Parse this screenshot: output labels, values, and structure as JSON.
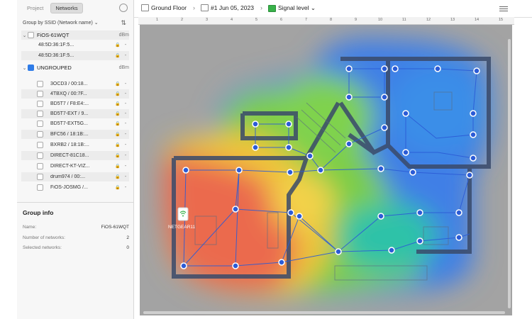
{
  "sidebar": {
    "tabs": [
      {
        "label": "Project",
        "active": false
      },
      {
        "label": "Networks",
        "active": true
      }
    ],
    "group_by": "Group by SSID (Network name) ⌄",
    "groups": [
      {
        "name": "FiOS-61WQT",
        "unit": "dBm",
        "networks": [
          {
            "name": "48:5D:36:1F:5..."
          },
          {
            "name": "48:5D:36:1F:5..."
          }
        ]
      },
      {
        "name": "UNGROUPED",
        "unit": "dBm",
        "networks": [
          {
            "name": "3OCD3 / 00:18..."
          },
          {
            "name": "4TBXQ / 00:7F..."
          },
          {
            "name": "BD5T7 / F8:E4:..."
          },
          {
            "name": "BD5T7-EXT / 9..."
          },
          {
            "name": "BD5T7-EXT5G..."
          },
          {
            "name": "BFC56 / 18:1B:..."
          },
          {
            "name": "BXRB2 / 18:1B:..."
          },
          {
            "name": "DIRECT-81C18..."
          },
          {
            "name": "DIRECT-KT-VIZ..."
          },
          {
            "name": "drum974 / 00:..."
          },
          {
            "name": "FiOS-JOSMG /..."
          }
        ]
      }
    ],
    "group_info": {
      "title": "Group info",
      "rows": [
        {
          "label": "Name:",
          "value": "FiOS-61WQT"
        },
        {
          "label": "Number of networks:",
          "value": "2"
        },
        {
          "label": "Selected networks:",
          "value": "0"
        }
      ]
    }
  },
  "topbar": {
    "crumbs": [
      "Ground Floor",
      "#1 Jun 05, 2023",
      "Signal level ⌄"
    ]
  },
  "ruler": [
    "1",
    "2",
    "3",
    "4",
    "5",
    "6",
    "7",
    "8",
    "9",
    "10",
    "11",
    "12",
    "13",
    "14",
    "15"
  ],
  "map": {
    "access_point_label": "NETGEAR11"
  }
}
